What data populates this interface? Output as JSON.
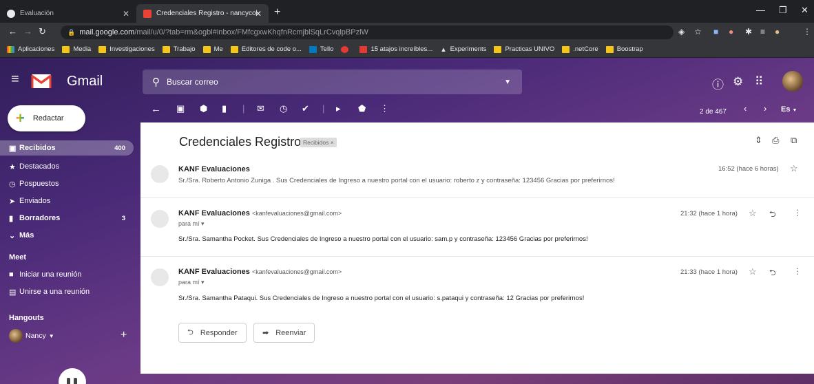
{
  "browser": {
    "tabs": [
      {
        "title": "Evaluación"
      },
      {
        "title": "Credenciales Registro - nancycol"
      }
    ],
    "url_host": "mail.google.com",
    "url_path": "/mail/u/0/?tab=rm&ogbl#inbox/FMfcgxwKhqfnRcmjblSqLrCvqlpBPzlW",
    "bookmarks": [
      "Aplicaciones",
      "Media",
      "Investigaciones",
      "Trabajo",
      "Me",
      "Editores de code o...",
      "Tello",
      "15 atajos increíbles...",
      "Experiments",
      "Practicas UNIVO",
      ".netCore",
      "Boostrap"
    ]
  },
  "gmail": {
    "app_name": "Gmail",
    "search_placeholder": "Buscar correo",
    "compose_label": "Redactar",
    "nav": [
      {
        "label": "Recibidos",
        "count": "400",
        "icon": "inbox-icon"
      },
      {
        "label": "Destacados",
        "count": "",
        "icon": "star-icon"
      },
      {
        "label": "Pospuestos",
        "count": "",
        "icon": "clock-icon"
      },
      {
        "label": "Enviados",
        "count": "",
        "icon": "send-icon"
      },
      {
        "label": "Borradores",
        "count": "3",
        "icon": "draft-icon"
      },
      {
        "label": "Más",
        "count": "",
        "icon": "chevron-down-icon"
      }
    ],
    "meet": {
      "title": "Meet",
      "items": [
        "Iniciar una reunión",
        "Unirse a una reunión"
      ]
    },
    "hangouts": {
      "title": "Hangouts",
      "user": "Nancy"
    },
    "pagination": "2 de 467",
    "language": "Es"
  },
  "thread": {
    "subject": "Credenciales Registro",
    "label": "Recibidos",
    "messages": [
      {
        "sender": "KANF Evaluaciones",
        "email": "",
        "time": "16:52 (hace 6 horas)",
        "snippet": "Sr./Sra. Roberto Antonio Zuniga . Sus Credenciales de Ingreso a nuestro portal con el usuario: roberto z y contraseña: 123456 Gracias por preferirnos!"
      },
      {
        "sender": "KANF Evaluaciones",
        "email": "<kanfevaluaciones@gmail.com>",
        "to": "para mí",
        "time": "21:32 (hace 1 hora)",
        "body": "Sr./Sra. Samantha Pocket. Sus Credenciales de Ingreso a nuestro portal con el usuario: sam.p y contraseña: 123456 Gracias por preferirnos!"
      },
      {
        "sender": "KANF Evaluaciones",
        "email": "<kanfevaluaciones@gmail.com>",
        "to": "para mí",
        "time": "21:33 (hace 1 hora)",
        "body": "Sr./Sra. Samantha Pataqui. Sus Credenciales de Ingreso a nuestro portal con el usuario: s.pataqui y contraseña: 12 Gracias por preferirnos!"
      }
    ],
    "reply_label": "Responder",
    "forward_label": "Reenviar"
  }
}
